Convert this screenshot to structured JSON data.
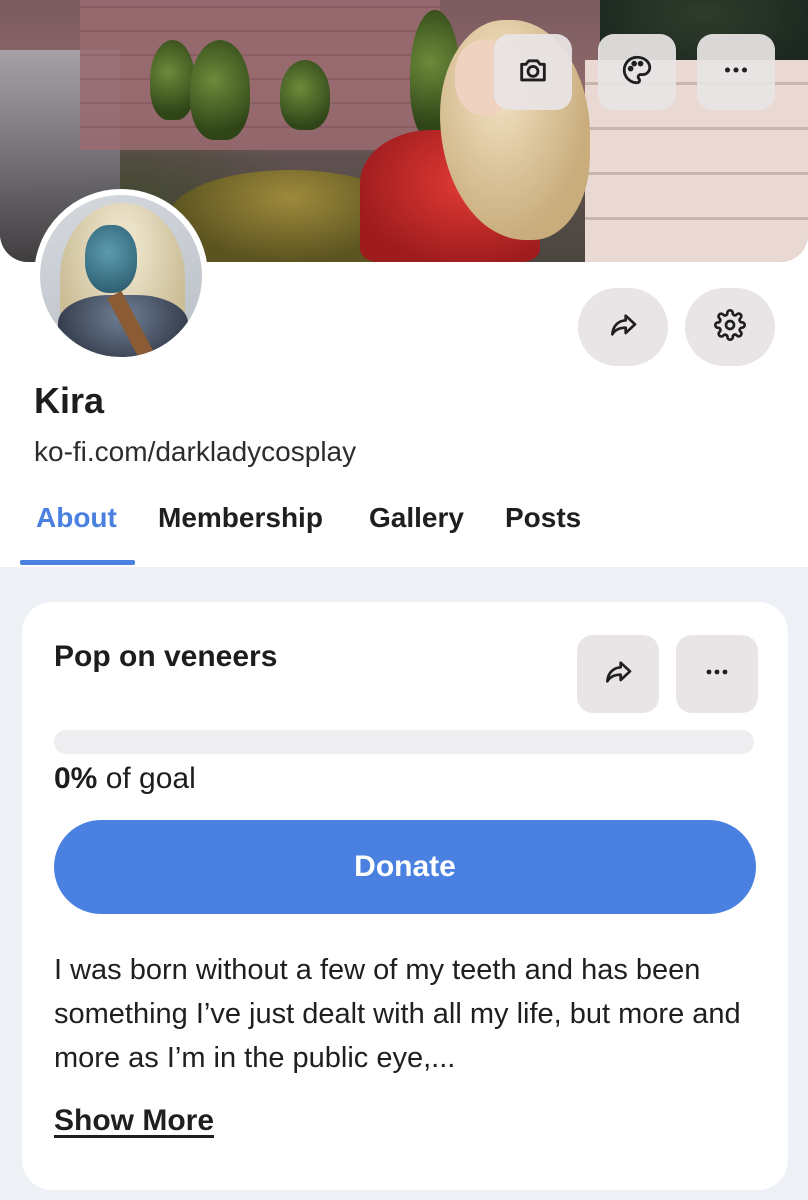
{
  "cover": {
    "camera_icon": "camera-icon",
    "palette_icon": "palette-icon",
    "more_icon": "more-horizontal-icon"
  },
  "profile": {
    "name": "Kira",
    "url": "ko-fi.com/darkladycosplay",
    "share_icon": "share-icon",
    "settings_icon": "gear-icon"
  },
  "tabs": [
    {
      "label": "About",
      "active": true
    },
    {
      "label": "Membership",
      "active": false
    },
    {
      "label": "Gallery",
      "active": false
    },
    {
      "label": "Posts",
      "active": false
    }
  ],
  "goal": {
    "title": "Pop on veneers",
    "progress": 0,
    "percent_label": "0%",
    "of_goal_label": " of goal",
    "donate_label": "Donate",
    "description": "I was born without a few of my teeth and has been something I’ve just dealt with all my life, but more and more as I’m in the public eye,...",
    "show_more_label": "Show More"
  },
  "colors": {
    "accent": "#4a80e0",
    "button_bg": "#e9e4e5",
    "content_bg": "#edf0f5"
  }
}
